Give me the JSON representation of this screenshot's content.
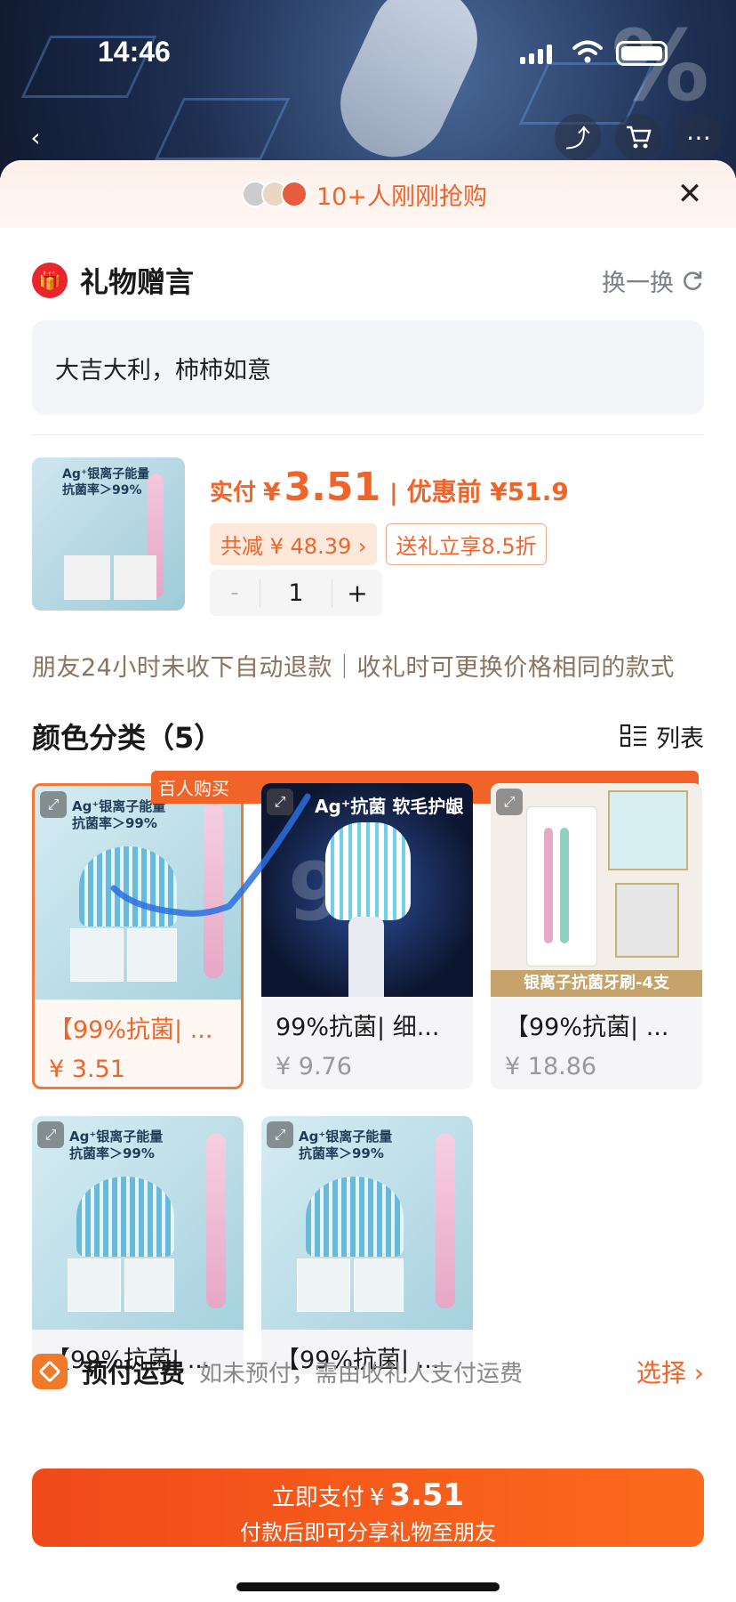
{
  "status_bar": {
    "time": "14:46"
  },
  "banner": {
    "text": "10+人刚刚抢购"
  },
  "gift": {
    "title": "礼物赠言",
    "swap_label": "换一换",
    "message": "大吉大利，柿柿如意"
  },
  "product": {
    "thumb_text": "Ag⁺银离子能量\n抗菌率＞99%",
    "pay_label": "实付",
    "currency": "¥",
    "pay_price": "3.51",
    "separator": "|",
    "original_price": "优惠前 ¥51.9",
    "discount_chip": "共减 ¥ 48.39 ›",
    "gift_chip": "送礼立享8.5折",
    "qty_minus": "-",
    "qty": "1",
    "qty_plus": "+"
  },
  "notice": "朋友24小时未收下自动退款｜收礼时可更换价格相同的款式",
  "color_section": {
    "title": "颜色分类（5）",
    "list_label": "列表",
    "items": [
      {
        "name": "【99%抗菌| ...",
        "price": "¥ 3.51",
        "badge": "百人购买",
        "image_text": "Ag⁺银离子能量\n抗菌率＞99%"
      },
      {
        "name": "99%抗菌| 细...",
        "price": "¥ 9.76",
        "image_text": "Ag⁺抗菌 软毛护龈"
      },
      {
        "name": "【99%抗菌| ...",
        "price": "¥ 18.86",
        "image_text": "银离子抗菌牙刷-4支"
      },
      {
        "name": "【99%抗菌| ...",
        "image_text": "Ag⁺银离子能量\n抗菌率＞99%"
      },
      {
        "name": "【99%抗菌| ...",
        "image_text": "Ag⁺银离子能量\n抗菌率＞99%"
      }
    ]
  },
  "shipping": {
    "title": "预付运费",
    "desc": "如未预付，需由收礼人支付运费",
    "action": "选择 ›"
  },
  "pay_button": {
    "label": "立即支付",
    "currency": "¥",
    "amount": "3.51",
    "subtitle": "付款后即可分享礼物至朋友"
  },
  "colors": {
    "accent": "#f0642a",
    "gift_red": "#e8242c"
  }
}
